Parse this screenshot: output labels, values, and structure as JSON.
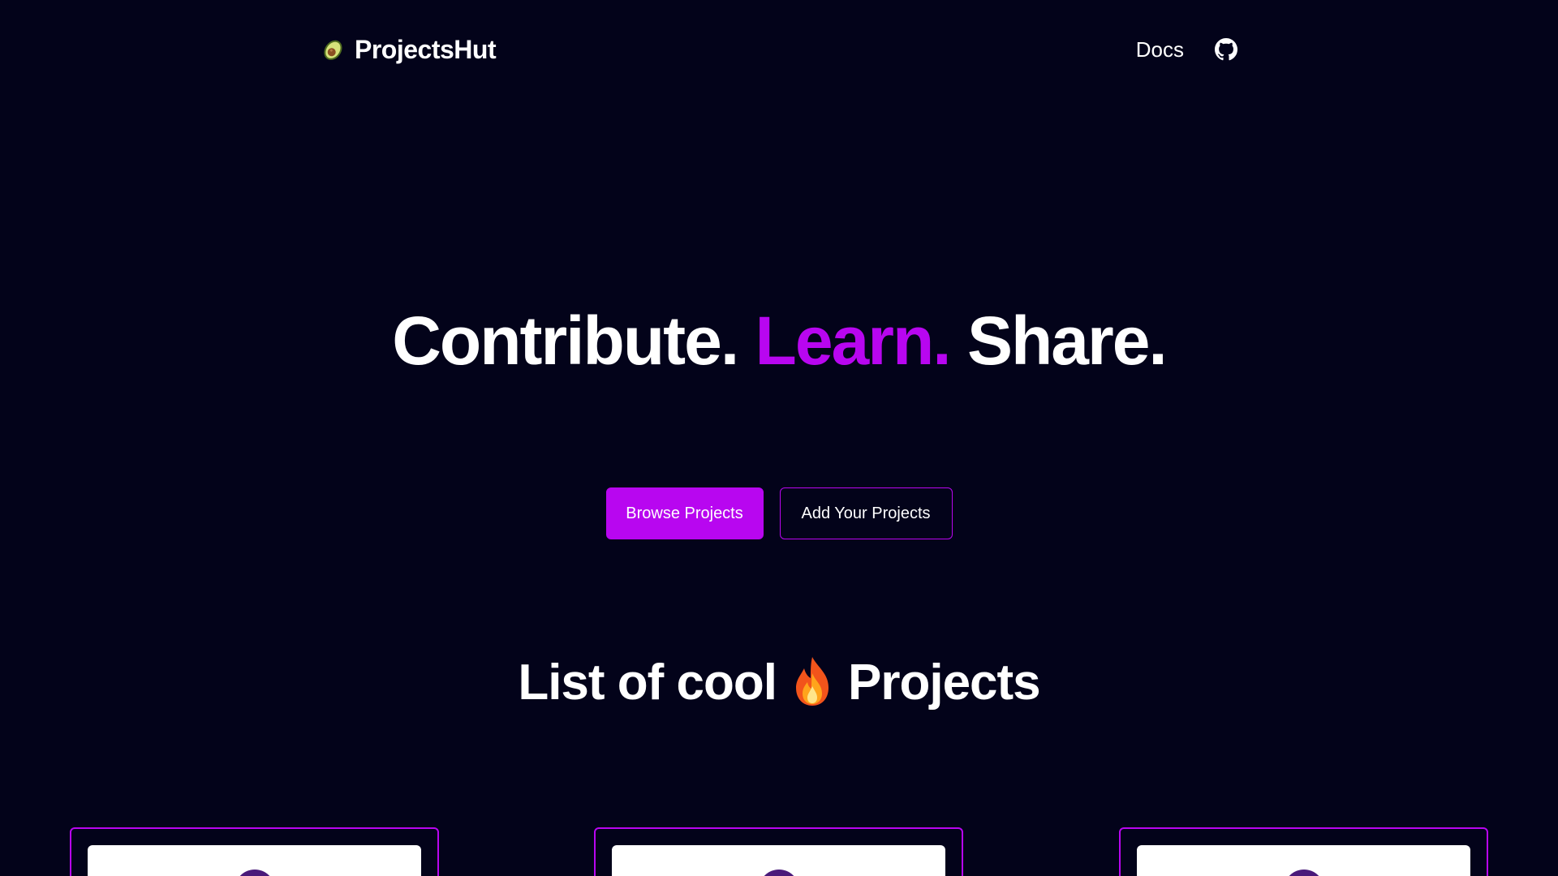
{
  "header": {
    "brand_name": "ProjectsHut",
    "brand_icon": "avocado-icon",
    "nav": {
      "docs_label": "Docs",
      "github_icon": "github-icon"
    }
  },
  "hero": {
    "title_part1": "Contribute.",
    "title_part2": "Learn.",
    "title_part3": "Share."
  },
  "actions": {
    "browse_label": "Browse Projects",
    "add_label": "Add Your Projects"
  },
  "projects_section": {
    "title_before": "List of cool",
    "title_icon": "fire-icon",
    "title_after": "Projects",
    "cards": [
      {
        "id": "card-1"
      },
      {
        "id": "card-2"
      },
      {
        "id": "card-3"
      }
    ]
  },
  "colors": {
    "background": "#03031a",
    "accent": "#b806f0",
    "text": "#ffffff"
  }
}
